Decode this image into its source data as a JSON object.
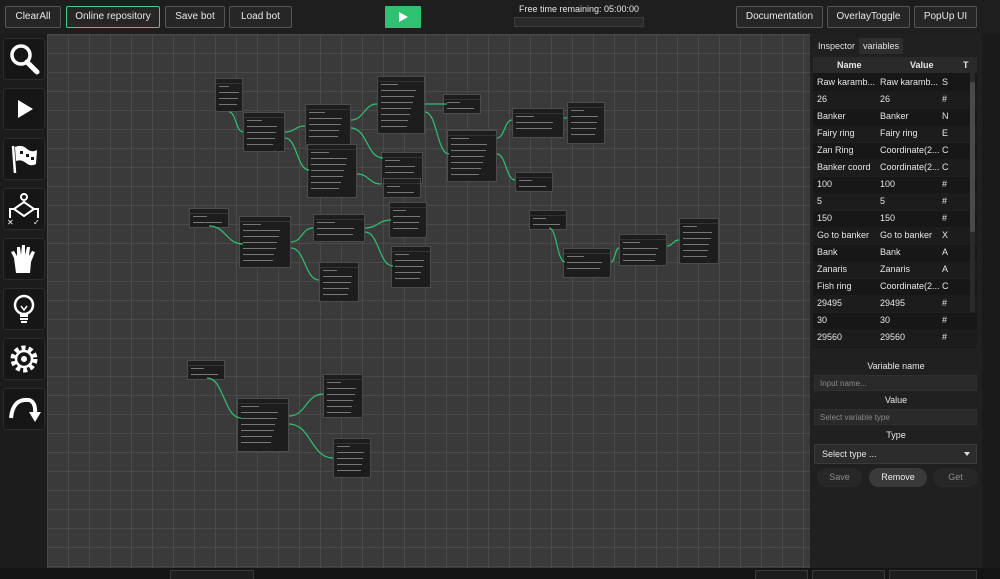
{
  "toolbar": {
    "clear_all": "ClearAll",
    "online_repository": "Online repository",
    "save_bot": "Save bot",
    "load_bot": "Load bot",
    "documentation": "Documentation",
    "overlay_toggle": "OverlayToggle",
    "popup_ui": "PopUp UI",
    "free_time": "Free time remaining: 05:00:00",
    "accent_color": "#2fc072"
  },
  "left_tools": [
    "search-icon",
    "play-icon",
    "flag-icon",
    "branch-icon",
    "hand-icon",
    "lightbulb-icon",
    "gear-icon",
    "redo-arrow-icon"
  ],
  "panel": {
    "tabs": [
      "Inspector",
      "variables"
    ],
    "active_tab": "variables",
    "columns": [
      "Name",
      "Value",
      "T"
    ],
    "rows": [
      [
        "Raw karamb...",
        "Raw karamb...",
        "S"
      ],
      [
        "26",
        "26",
        "#"
      ],
      [
        "Banker",
        "Banker",
        "N"
      ],
      [
        "Fairy ring",
        "Fairy ring",
        "E"
      ],
      [
        "Zan Ring",
        "Coordinate(2...",
        "C"
      ],
      [
        "Banker coord",
        "Coordinate(2...",
        "C"
      ],
      [
        "100",
        "100",
        "#"
      ],
      [
        "5",
        "5",
        "#"
      ],
      [
        "150",
        "150",
        "#"
      ],
      [
        "Go to banker",
        "Go to banker",
        "X"
      ],
      [
        "Bank",
        "Bank",
        "A"
      ],
      [
        "Zanaris",
        "Zanaris",
        "A"
      ],
      [
        "Fish ring",
        "Coordinate(2...",
        "C"
      ],
      [
        "29495",
        "29495",
        "#"
      ],
      [
        "30",
        "30",
        "#"
      ],
      [
        "29560",
        "29560",
        "#"
      ]
    ],
    "variable_name_label": "Variable name",
    "variable_name_placeholder": "Input name...",
    "value_label": "Value",
    "value_placeholder": "Select variable type",
    "type_label": "Type",
    "type_select": "Select type ...",
    "save": "Save",
    "remove": "Remove",
    "get": "Get"
  }
}
